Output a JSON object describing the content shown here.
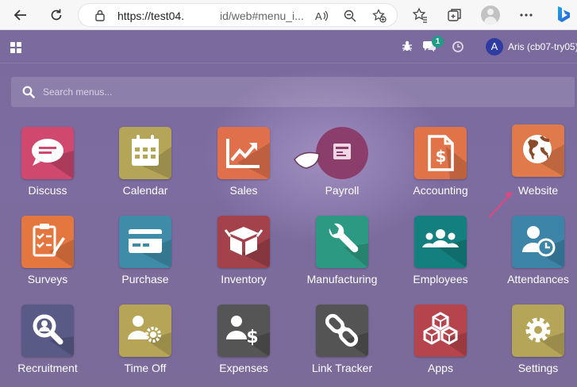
{
  "browser": {
    "url_part1": "https://test04.",
    "url_part2": "id/web#menu_i..."
  },
  "topbar": {
    "chat_badge": "1",
    "avatar_letter": "A",
    "user_name": "Aris (cb07-try05)"
  },
  "search": {
    "placeholder": "Search menus..."
  },
  "colors": {
    "background": "#7b6c9c",
    "discuss": "#d1486f",
    "calendar": "#b5a558",
    "sales": "#e0704c",
    "payroll": "#8b3d6b",
    "accounting": "#e07348",
    "website": "#e07a4a",
    "surveys": "#e4763f",
    "purchase": "#3f8ca8",
    "inventory": "#a4424c",
    "manufacturing": "#2c9a82",
    "employees": "#13807f",
    "attendances": "#3c84a8",
    "recruitment": "#595a86",
    "timeoff": "#b6a556",
    "expenses": "#555555",
    "linktracker": "#545454",
    "apps": "#b5444c",
    "settings": "#b5a558",
    "chat_badge": "#1f9b86",
    "avatar": "#2f3ba1"
  },
  "apps": [
    {
      "label": "Discuss",
      "icon": "speech-bubble-icon"
    },
    {
      "label": "Calendar",
      "icon": "calendar-icon"
    },
    {
      "label": "Sales",
      "icon": "trend-chart-icon"
    },
    {
      "label": "Payroll",
      "icon": "payroll-icon"
    },
    {
      "label": "Accounting",
      "icon": "invoice-dollar-icon"
    },
    {
      "label": "Website",
      "icon": "globe-icon"
    },
    {
      "label": "Surveys",
      "icon": "clipboard-check-icon"
    },
    {
      "label": "Purchase",
      "icon": "credit-card-icon"
    },
    {
      "label": "Inventory",
      "icon": "box-icon"
    },
    {
      "label": "Manufacturing",
      "icon": "wrench-icon"
    },
    {
      "label": "Employees",
      "icon": "users-icon"
    },
    {
      "label": "Attendances",
      "icon": "user-clock-icon"
    },
    {
      "label": "Recruitment",
      "icon": "magnifier-icon"
    },
    {
      "label": "Time Off",
      "icon": "user-gear-icon"
    },
    {
      "label": "Expenses",
      "icon": "user-dollar-icon"
    },
    {
      "label": "Link Tracker",
      "icon": "chain-link-icon"
    },
    {
      "label": "Apps",
      "icon": "cubes-icon"
    },
    {
      "label": "Settings",
      "icon": "gear-icon"
    }
  ]
}
